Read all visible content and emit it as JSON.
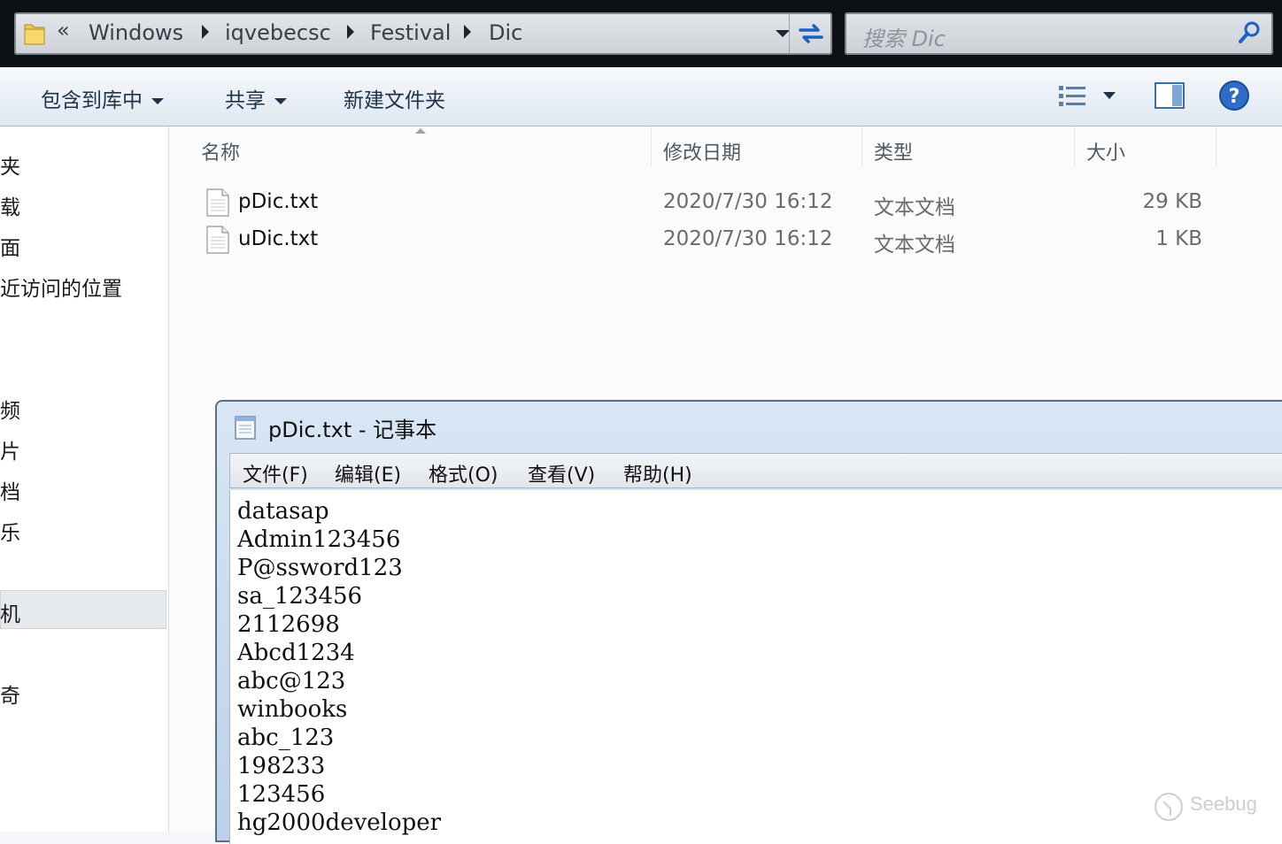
{
  "address": {
    "overflow": "«",
    "crumbs": [
      "Windows",
      "iqvebecsc",
      "Festival",
      "Dic"
    ]
  },
  "search": {
    "placeholder": "搜索 Dic"
  },
  "toolbar": {
    "include_library": "包含到库中",
    "share": "共享",
    "new_folder": "新建文件夹"
  },
  "nav": {
    "items": [
      "夹",
      "载",
      "面",
      "近访问的位置",
      "频",
      "片",
      "档",
      "乐",
      "机",
      "奇"
    ]
  },
  "columns": {
    "name": "名称",
    "modified": "修改日期",
    "type": "类型",
    "size": "大小"
  },
  "files": [
    {
      "name": "pDic.txt",
      "modified": "2020/7/30 16:12",
      "type": "文本文档",
      "size": "29 KB"
    },
    {
      "name": "uDic.txt",
      "modified": "2020/7/30 16:12",
      "type": "文本文档",
      "size": "1 KB"
    }
  ],
  "notepad": {
    "title": "pDic.txt - 记事本",
    "menus": [
      "文件(F)",
      "编辑(E)",
      "格式(O)",
      "查看(V)",
      "帮助(H)"
    ],
    "lines": [
      "datasap",
      "Admin123456",
      "P@ssword123",
      "sa_123456",
      "2112698",
      "Abcd1234",
      "abc@123",
      "winbooks",
      "abc_123",
      "198233",
      "123456",
      "hg2000developer"
    ]
  },
  "watermark": {
    "text": "Seebug"
  },
  "colors": {
    "accent_blue": "#1f5fc4",
    "toolbar_text": "#1e3348",
    "address_bg": "#d6d9dd"
  },
  "icons": {
    "folder": "folder-icon",
    "refresh": "refresh-icon",
    "search": "search-icon",
    "views": "view-list-icon",
    "preview_pane": "preview-pane-icon",
    "help": "help-icon",
    "file": "text-file-icon",
    "notepad": "notepad-icon"
  }
}
